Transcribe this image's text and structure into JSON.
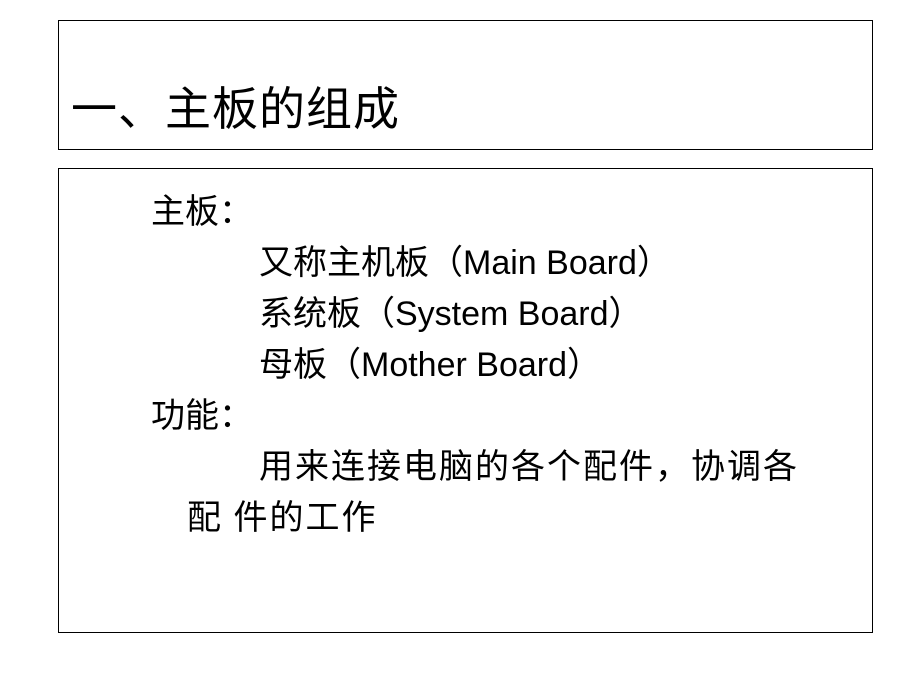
{
  "title": "一、主板的组成",
  "content": {
    "label1": "主板：",
    "alias1": "又称主机板（Main Board）",
    "alias2": "系统板（System Board）",
    "alias3": "母板（Mother Board）",
    "label2": "功能：",
    "body_line1": "用来连接电脑的各个配件，协调各",
    "body_line2": "配 件的工作"
  }
}
